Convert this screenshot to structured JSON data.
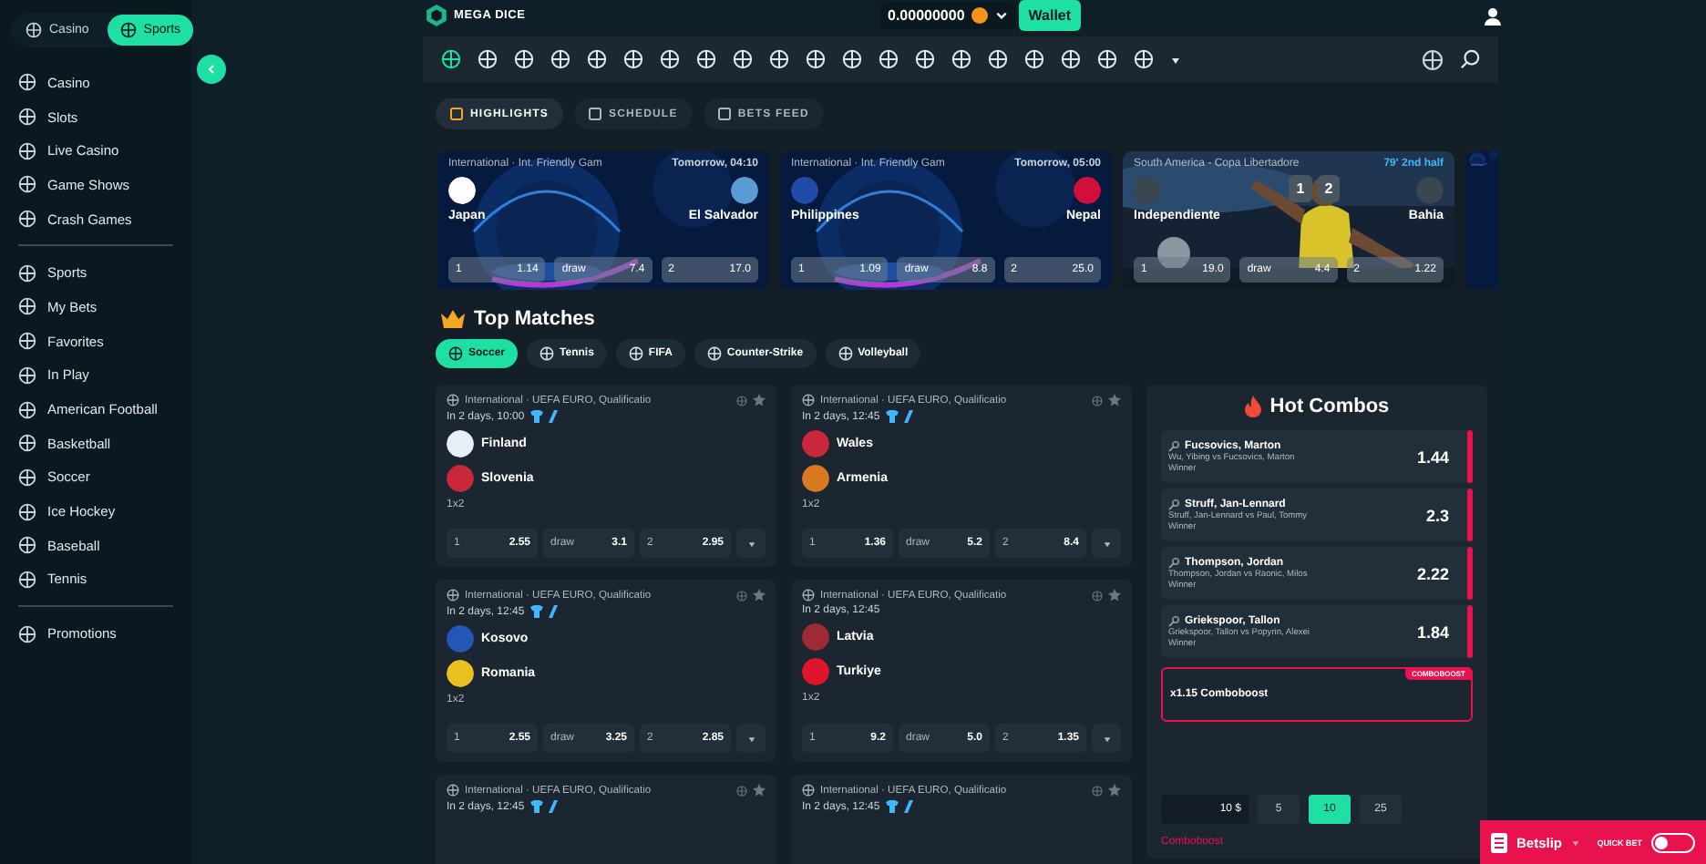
{
  "sidebar": {
    "switch": [
      {
        "label": "Casino",
        "selected": false
      },
      {
        "label": "Sports",
        "selected": true
      }
    ],
    "groups": [
      [
        {
          "label": "Casino"
        },
        {
          "label": "Slots"
        },
        {
          "label": "Live Casino"
        },
        {
          "label": "Game Shows"
        },
        {
          "label": "Crash Games"
        }
      ],
      [
        {
          "label": "Sports"
        },
        {
          "label": "My Bets"
        },
        {
          "label": "Favorites"
        },
        {
          "label": "In Play"
        },
        {
          "label": "American Football"
        },
        {
          "label": "Basketball"
        },
        {
          "label": "Soccer"
        },
        {
          "label": "Ice Hockey"
        },
        {
          "label": "Baseball"
        },
        {
          "label": "Tennis"
        }
      ],
      [
        {
          "label": "Promotions"
        }
      ]
    ]
  },
  "header": {
    "logo": "MEGA DICE",
    "balance": "0.00000000",
    "wallet": "Wallet"
  },
  "nav": [
    {
      "selected": true
    },
    {
      "selected": false
    },
    {
      "selected": false
    },
    {
      "selected": false
    },
    {
      "selected": false
    },
    {
      "selected": false
    },
    {
      "selected": false
    },
    {
      "selected": false
    },
    {
      "selected": false
    },
    {
      "selected": false
    },
    {
      "selected": false
    },
    {
      "selected": false
    },
    {
      "selected": false
    },
    {
      "selected": false
    },
    {
      "selected": false
    },
    {
      "selected": false
    },
    {
      "selected": false
    },
    {
      "selected": false
    },
    {
      "selected": false
    },
    {
      "selected": false
    }
  ],
  "views": [
    {
      "label": "HIGHLIGHTS",
      "selected": true
    },
    {
      "label": "SCHEDULE",
      "selected": false
    },
    {
      "label": "BETS FEED",
      "selected": false
    }
  ],
  "featured": [
    {
      "league": "International · Int. Friendly Gam",
      "time": "Tomorrow, 04:10",
      "live": false,
      "home": {
        "name": "Japan",
        "color": "#ffffff"
      },
      "away": {
        "name": "El Salvador",
        "color": "#5b9bd5"
      },
      "odds": [
        {
          "label": "1",
          "value": "1.14"
        },
        {
          "label": "draw",
          "value": "7.4"
        },
        {
          "label": "2",
          "value": "17.0"
        }
      ]
    },
    {
      "league": "International · Int. Friendly Gam",
      "time": "Tomorrow, 05:00",
      "live": false,
      "home": {
        "name": "Philippines",
        "color": "#1f4aa8"
      },
      "away": {
        "name": "Nepal",
        "color": "#d0103a"
      },
      "odds": [
        {
          "label": "1",
          "value": "1.09"
        },
        {
          "label": "draw",
          "value": "8.8"
        },
        {
          "label": "2",
          "value": "25.0"
        }
      ]
    },
    {
      "league": "South America - Copa Libertadore",
      "time": "79' 2nd half",
      "live": true,
      "score": [
        "1",
        "2"
      ],
      "home": {
        "name": "Independiente",
        "color": "#3a4650"
      },
      "away": {
        "name": "Bahia",
        "color": "#3a4650"
      },
      "odds": [
        {
          "label": "1",
          "value": "19.0"
        },
        {
          "label": "draw",
          "value": "4.4"
        },
        {
          "label": "2",
          "value": "1.22"
        }
      ]
    }
  ],
  "top_matches": {
    "title": "Top Matches",
    "sports": [
      {
        "label": "Soccer",
        "selected": true
      },
      {
        "label": "Tennis",
        "selected": false
      },
      {
        "label": "FIFA",
        "selected": false
      },
      {
        "label": "Counter-Strike",
        "selected": false
      },
      {
        "label": "Volleyball",
        "selected": false
      }
    ]
  },
  "matches": [
    {
      "league": "International · UEFA EURO, Qualificatio",
      "time": "In 2 days, 10:00",
      "jerseys": true,
      "teams": [
        {
          "name": "Finland",
          "color": "#e8eef5"
        },
        {
          "name": "Slovenia",
          "color": "#c8283a"
        }
      ],
      "market": "1x2",
      "odds": [
        {
          "label": "1",
          "value": "2.55"
        },
        {
          "label": "draw",
          "value": "3.1"
        },
        {
          "label": "2",
          "value": "2.95"
        }
      ]
    },
    {
      "league": "International · UEFA EURO, Qualificatio",
      "time": "In 2 days, 12:45",
      "jerseys": true,
      "teams": [
        {
          "name": "Wales",
          "color": "#c8283a"
        },
        {
          "name": "Armenia",
          "color": "#d97a20"
        }
      ],
      "market": "1x2",
      "odds": [
        {
          "label": "1",
          "value": "1.36"
        },
        {
          "label": "draw",
          "value": "5.2"
        },
        {
          "label": "2",
          "value": "8.4"
        }
      ]
    },
    {
      "league": "International · UEFA EURO, Qualificatio",
      "time": "In 2 days, 12:45",
      "jerseys": true,
      "teams": [
        {
          "name": "Kosovo",
          "color": "#2456b8"
        },
        {
          "name": "Romania",
          "color": "#e8c020"
        }
      ],
      "market": "1x2",
      "odds": [
        {
          "label": "1",
          "value": "2.55"
        },
        {
          "label": "draw",
          "value": "3.25"
        },
        {
          "label": "2",
          "value": "2.85"
        }
      ]
    },
    {
      "league": "International · UEFA EURO, Qualificatio",
      "time": "In 2 days, 12:45",
      "jerseys": false,
      "teams": [
        {
          "name": "Latvia",
          "color": "#9e2a35"
        },
        {
          "name": "Turkiye",
          "color": "#e0142a"
        }
      ],
      "market": "1x2",
      "odds": [
        {
          "label": "1",
          "value": "9.2"
        },
        {
          "label": "draw",
          "value": "5.0"
        },
        {
          "label": "2",
          "value": "1.35"
        }
      ]
    },
    {
      "league": "International · UEFA EURO, Qualificatio",
      "time": "In 2 days, 12:45",
      "jerseys": true
    },
    {
      "league": "International · UEFA EURO, Qualificatio",
      "time": "In 2 days, 12:45",
      "jerseys": true
    }
  ],
  "hot_combos": {
    "title": "Hot Combos",
    "rows": [
      {
        "name": "Fucsovics, Marton",
        "match": "Wu, Yibing vs Fucsovics, Marton",
        "market": "Winner",
        "odds": "1.44"
      },
      {
        "name": "Struff, Jan-Lennard",
        "match": "Struff, Jan-Lennard vs Paul, Tommy",
        "market": "Winner",
        "odds": "2.3"
      },
      {
        "name": "Thompson, Jordan",
        "match": "Thompson, Jordan vs Raonic, Milos",
        "market": "Winner",
        "odds": "2.22"
      },
      {
        "name": "Griekspoor, Tallon",
        "match": "Griekspoor, Tallon vs Popyrin, Alexei",
        "market": "Winner",
        "odds": "1.84"
      }
    ],
    "boost_tag": "COMBOBOOST",
    "boost": "x1.15 Comboboost",
    "stake": "10 $",
    "stakes": [
      {
        "label": "5",
        "selected": false
      },
      {
        "label": "10",
        "selected": true
      },
      {
        "label": "25",
        "selected": false
      }
    ],
    "footer": "Comboboost"
  },
  "betslip": {
    "label": "Betslip",
    "quick_bet": "QUICK BET",
    "quick_bet_on": false
  }
}
